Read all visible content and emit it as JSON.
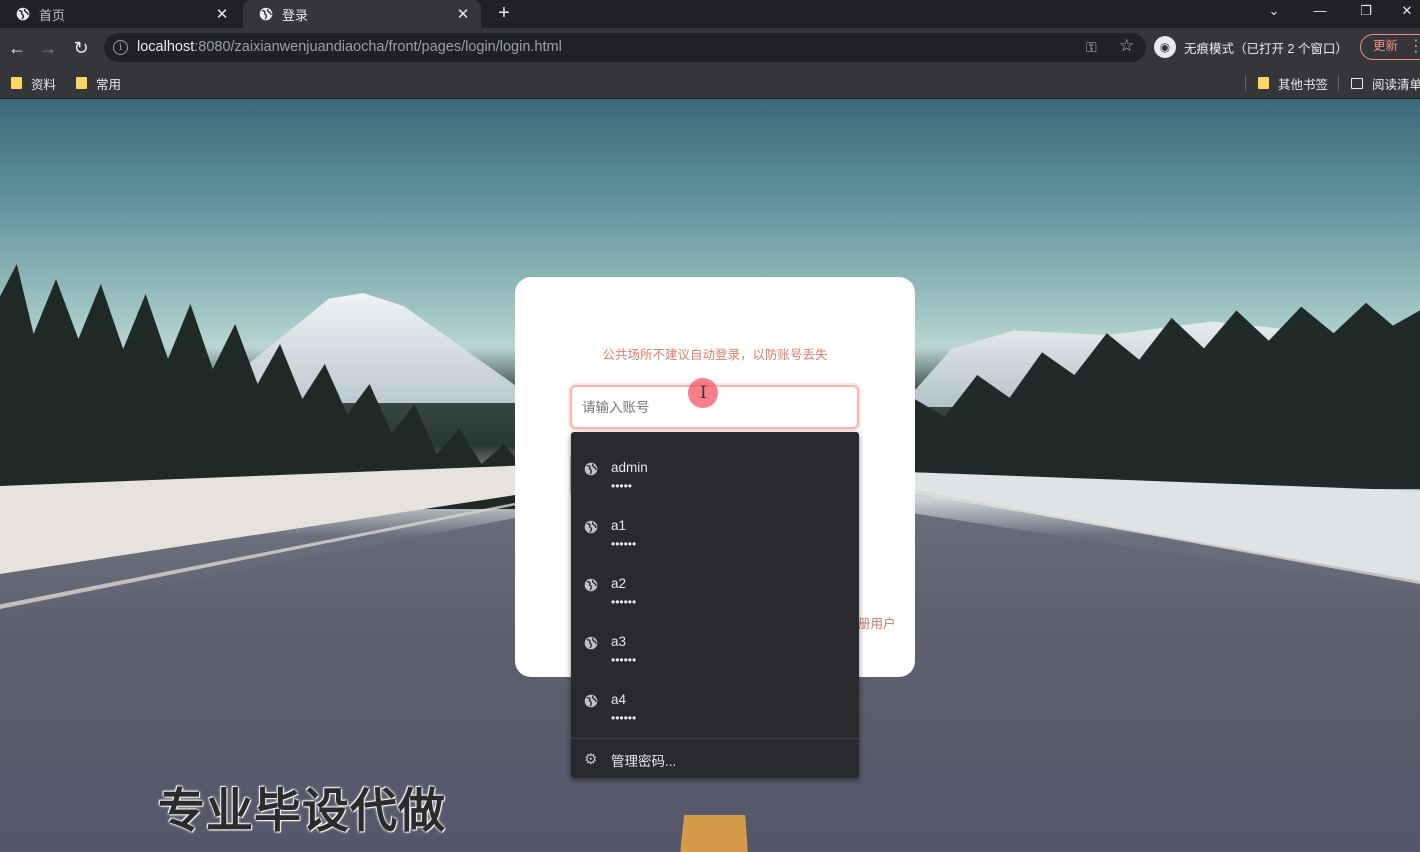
{
  "browser": {
    "tabs": [
      {
        "title": "首页",
        "active": false
      },
      {
        "title": "登录",
        "active": true
      }
    ],
    "url_host": "localhost",
    "url_rest": ":8080/zaixianwenjuandiaocha/front/pages/login/login.html",
    "incognito_label": "无痕模式（已打开 2 个窗口）",
    "update_label": "更新",
    "bookmarks": [
      {
        "label": "资料",
        "icon": "folder-icon"
      },
      {
        "label": "常用",
        "icon": "folder-icon"
      }
    ],
    "bookmarks_right": [
      {
        "label": "其他书签",
        "icon": "folder-icon"
      },
      {
        "label": "阅读清单",
        "icon": "reading-list-icon"
      }
    ]
  },
  "login": {
    "hint": "公共场所不建议自动登录，以防账号丢失",
    "username_placeholder": "请输入账号",
    "register_link": "册用户"
  },
  "autofill": {
    "items": [
      {
        "username": "admin",
        "password_mask": "•••••"
      },
      {
        "username": "a1",
        "password_mask": "••••••"
      },
      {
        "username": "a2",
        "password_mask": "••••••"
      },
      {
        "username": "a3",
        "password_mask": "••••••"
      },
      {
        "username": "a4",
        "password_mask": "••••••"
      }
    ],
    "manage_label": "管理密码..."
  },
  "watermark": "专业毕设代做",
  "colors": {
    "accent": "#e07d66",
    "chrome_dark": "#202124",
    "chrome_toolbar": "#35363a",
    "autofill_bg": "#292a2d"
  }
}
